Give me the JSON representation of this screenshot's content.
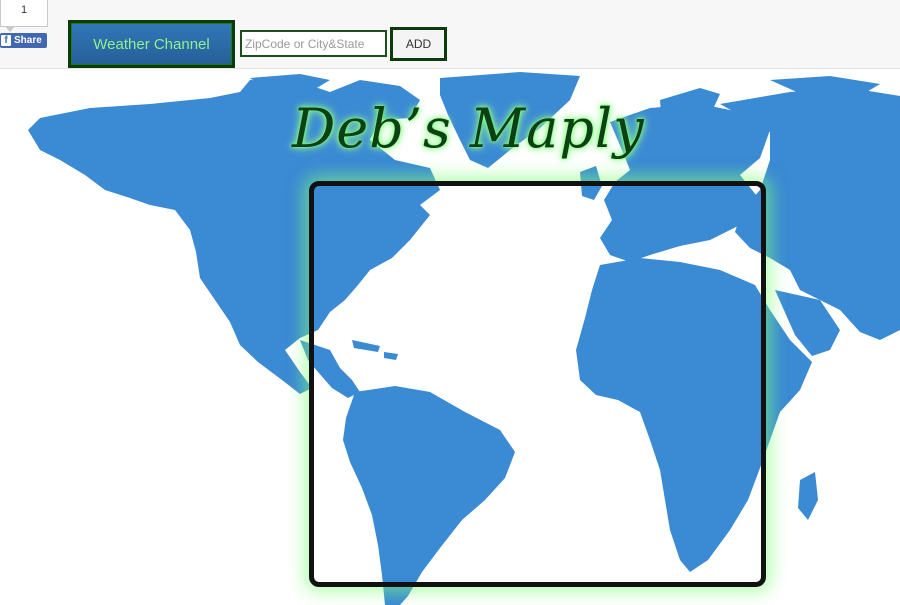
{
  "facebook": {
    "count": "1",
    "share_label": "Share",
    "icon": "facebook-f-icon"
  },
  "toolbar": {
    "weather_label": "Weather Channel",
    "search_placeholder": "ZipCode or City&State",
    "search_value": "",
    "add_label": "ADD"
  },
  "header": {
    "title": "Deb’s Maply"
  },
  "colors": {
    "map_land": "#3a8ad4",
    "title_text": "#0d4012",
    "title_glow": "#7dff7d",
    "weather_button_bg": "#2b6aa8",
    "weather_button_text": "#8ff08f",
    "frame_border": "#111111"
  }
}
